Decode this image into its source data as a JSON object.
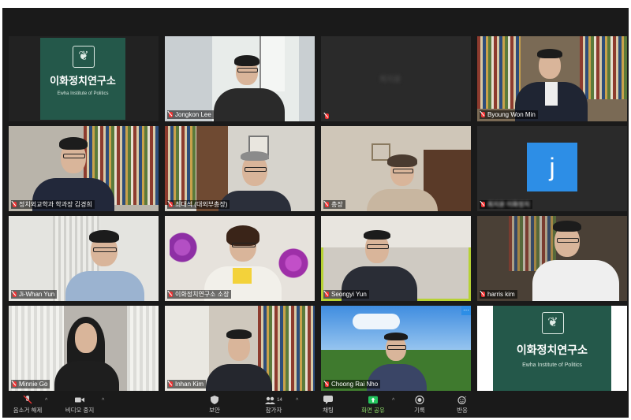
{
  "app": "Zoom",
  "participants": [
    {
      "name": "",
      "kind": "logo"
    },
    {
      "name": "Jongkon Lee",
      "kind": "video"
    },
    {
      "name": "",
      "kind": "blank",
      "blurred_label": "최지윤"
    },
    {
      "name": "Byoung Won Min",
      "kind": "video"
    },
    {
      "name": "정치외교학과 학과장 김경희",
      "kind": "video"
    },
    {
      "name": "최대석 (대외부총장)",
      "kind": "video"
    },
    {
      "name": "총장",
      "kind": "video"
    },
    {
      "name": "최지윤 이화정치",
      "kind": "avatar",
      "avatar_letter": "j"
    },
    {
      "name": "Ji-Whan Yun",
      "kind": "video"
    },
    {
      "name": "이화정치연구소 소장",
      "kind": "video"
    },
    {
      "name": "Seongyi Yun",
      "kind": "video",
      "active_speaker": true
    },
    {
      "name": "harris kim",
      "kind": "video"
    },
    {
      "name": "Minnie Go",
      "kind": "video"
    },
    {
      "name": "Inhan Kim",
      "kind": "video"
    },
    {
      "name": "Choong Rai Nho",
      "kind": "video"
    },
    {
      "name": "",
      "kind": "logo-framed"
    }
  ],
  "logo": {
    "title": "이화정치연구소",
    "subtitle": "Ewha Institute of Politics",
    "emblem": "ewha-emblem-icon"
  },
  "toolbar": {
    "mute": "음소거 해제",
    "video": "비디오 중지",
    "security": "보안",
    "participants": "참가자",
    "participants_count": "14",
    "chat": "채팅",
    "share": "화면 공유",
    "record": "기록",
    "reactions": "반응"
  },
  "colors": {
    "logo_green": "#24584a",
    "active_speaker": "#b7d234",
    "share_green": "#22c55e",
    "avatar_blue": "#2d8ee6",
    "muted_red": "#e33333"
  }
}
